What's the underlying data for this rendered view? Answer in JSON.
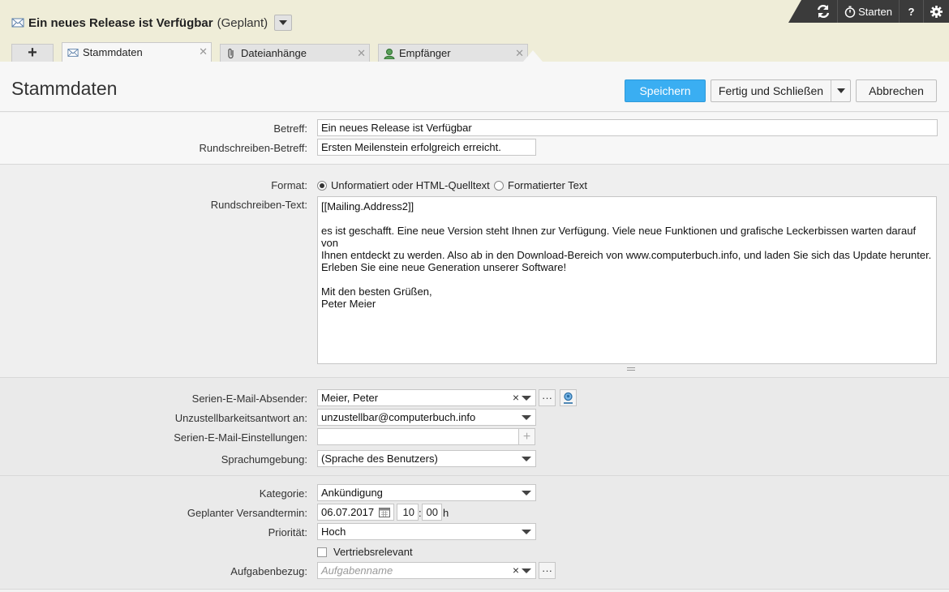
{
  "header": {
    "title": "Ein neues Release ist Verfügbar",
    "status": "(Geplant)",
    "icon": "mail-icon"
  },
  "toolbar": {
    "refresh_icon": "refresh-icon",
    "start_label": "Starten",
    "help_label": "?",
    "settings_icon": "gear-icon"
  },
  "tabs": [
    {
      "label": "Stammdaten",
      "icon": "mail-icon",
      "active": true
    },
    {
      "label": "Dateianhänge",
      "icon": "paperclip-icon",
      "active": false
    },
    {
      "label": "Empfänger",
      "icon": "person-icon",
      "active": false
    }
  ],
  "page": {
    "title": "Stammdaten",
    "save_label": "Speichern",
    "finish_label": "Fertig und Schließen",
    "cancel_label": "Abbrechen"
  },
  "form": {
    "betreff_label": "Betreff:",
    "betreff_value": "Ein neues Release ist Verfügbar",
    "rs_betreff_label": "Rundschreiben-Betreff:",
    "rs_betreff_value": "Ersten Meilenstein erfolgreich erreicht.",
    "format_label": "Format:",
    "format_option1": "Unformatiert oder HTML-Quelltext",
    "format_option2": "Formatierter Text",
    "format_selected": "Unformatiert oder HTML-Quelltext",
    "rs_text_label": "Rundschreiben-Text:",
    "rs_text_line1": "[[Mailing.Address2]]",
    "rs_text_line2": "es ist geschafft. Eine neue Version steht Ihnen zur Verfügung. Viele neue Funktionen und grafische Leckerbissen warten darauf von",
    "rs_text_line3": "Ihnen entdeckt zu werden. Also ab in den Download-Bereich von www.computerbuch.info, und laden Sie sich das Update herunter.",
    "rs_text_line4": "Erleben Sie eine neue Generation unserer Software!",
    "rs_text_line5": "Mit den besten Grüßen,",
    "rs_text_line6": "Peter Meier",
    "absender_label": "Serien-E-Mail-Absender:",
    "absender_value": "Meier, Peter",
    "unzustell_label": "Unzustellbarkeitsantwort an:",
    "unzustell_value": "unzustellbar@computerbuch.info",
    "einstellungen_label": "Serien-E-Mail-Einstellungen:",
    "einstellungen_value": "",
    "sprache_label": "Sprachumgebung:",
    "sprache_value": "(Sprache des Benutzers)",
    "kategorie_label": "Kategorie:",
    "kategorie_value": "Ankündigung",
    "versand_label": "Geplanter Versandtermin:",
    "versand_date": "06.07.2017",
    "versand_hour": "10",
    "versand_minute": "00",
    "versand_unit": "h",
    "prioritaet_label": "Priorität:",
    "prioritaet_value": "Hoch",
    "vertrieb_label": "Vertriebsrelevant",
    "vertrieb_checked": false,
    "aufgabe_label": "Aufgabenbezug:",
    "aufgabe_placeholder": "Aufgabenname",
    "more_label": "···",
    "colon": ":",
    "clear_label": "×"
  },
  "colors": {
    "accent": "#3aaef2",
    "header_band": "#efedd8",
    "toolbar": "#3b3b3b"
  }
}
